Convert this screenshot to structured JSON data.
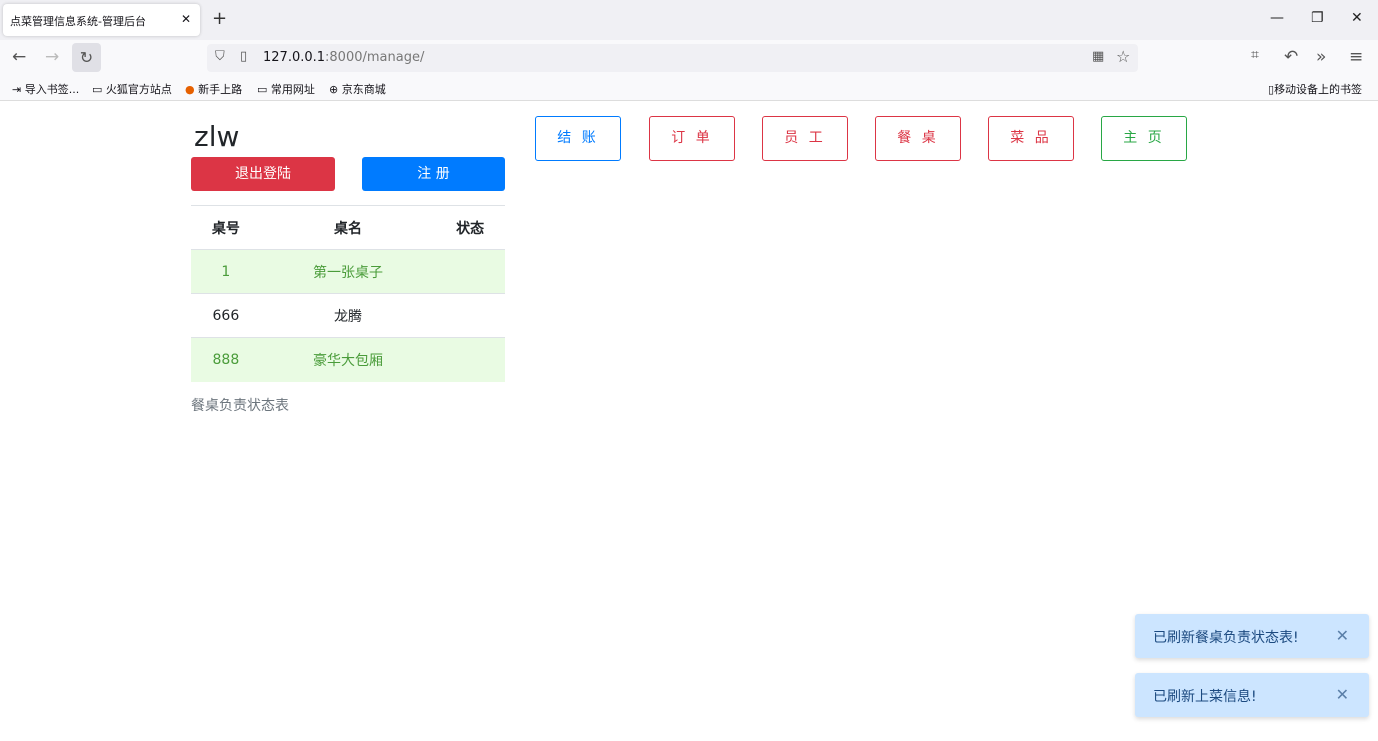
{
  "browser": {
    "tab_title": "点菜管理信息系统-管理后台",
    "url_host": "127.0.0.1",
    "url_rest": ":8000/manage/",
    "bookmarks": [
      "导入书签...",
      "火狐官方站点",
      "新手上路",
      "常用网址",
      "京东商城"
    ],
    "mobile_bookmarks": "移动设备上的书签"
  },
  "user": {
    "name": "zlw",
    "logout": "退出登陆",
    "register": "注 册"
  },
  "nav": [
    {
      "label": "结 账",
      "color": "#007bff"
    },
    {
      "label": "订 单",
      "color": "#dc3545"
    },
    {
      "label": "员 工",
      "color": "#dc3545"
    },
    {
      "label": "餐 桌",
      "color": "#dc3545"
    },
    {
      "label": "菜 品",
      "color": "#dc3545"
    },
    {
      "label": "主 页",
      "color": "#28a745"
    }
  ],
  "table": {
    "headers": [
      "桌号",
      "桌名",
      "状态"
    ],
    "rows": [
      [
        "1",
        "第一张桌子",
        ""
      ],
      [
        "666",
        "龙腾",
        ""
      ],
      [
        "888",
        "豪华大包厢",
        ""
      ]
    ],
    "caption": "餐桌负责状态表"
  },
  "toasts": [
    "已刷新餐桌负责状态表!",
    "已刷新上菜信息!"
  ]
}
